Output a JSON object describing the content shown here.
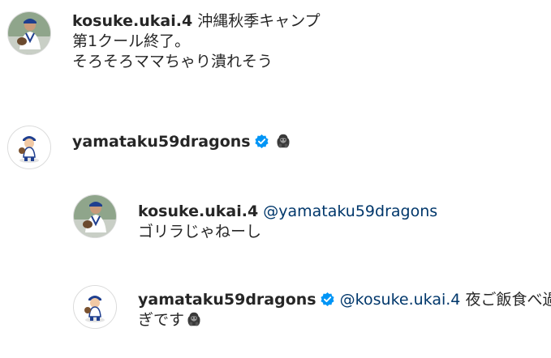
{
  "comments": [
    {
      "username": "kosuke.ukai.4",
      "verified": false,
      "lines": [
        "沖縄秋季キャンプ",
        "第1クール終了。",
        "そろそろママちゃり潰れそう"
      ],
      "avatar": "player-photo-avatar"
    },
    {
      "username": "yamataku59dragons",
      "verified": true,
      "emoji": "gorilla-emoji",
      "avatar": "cartoon-player-avatar"
    },
    {
      "username": "kosuke.ukai.4",
      "verified": false,
      "mention": "@yamataku59dragons",
      "lines": [
        "ゴリラじゃねーし"
      ],
      "avatar": "player-photo-avatar"
    },
    {
      "username": "yamataku59dragons",
      "verified": true,
      "mention": "@kosuke.ukai.4",
      "text_first": "夜ご飯食べ過",
      "text_second": "ぎです",
      "emoji": "gorilla-emoji",
      "avatar": "cartoon-player-avatar"
    }
  ],
  "colors": {
    "text": "#262626",
    "mention": "#00376b",
    "verified_badge": "#0095f6",
    "avatar_border": "#dbdbdb"
  }
}
